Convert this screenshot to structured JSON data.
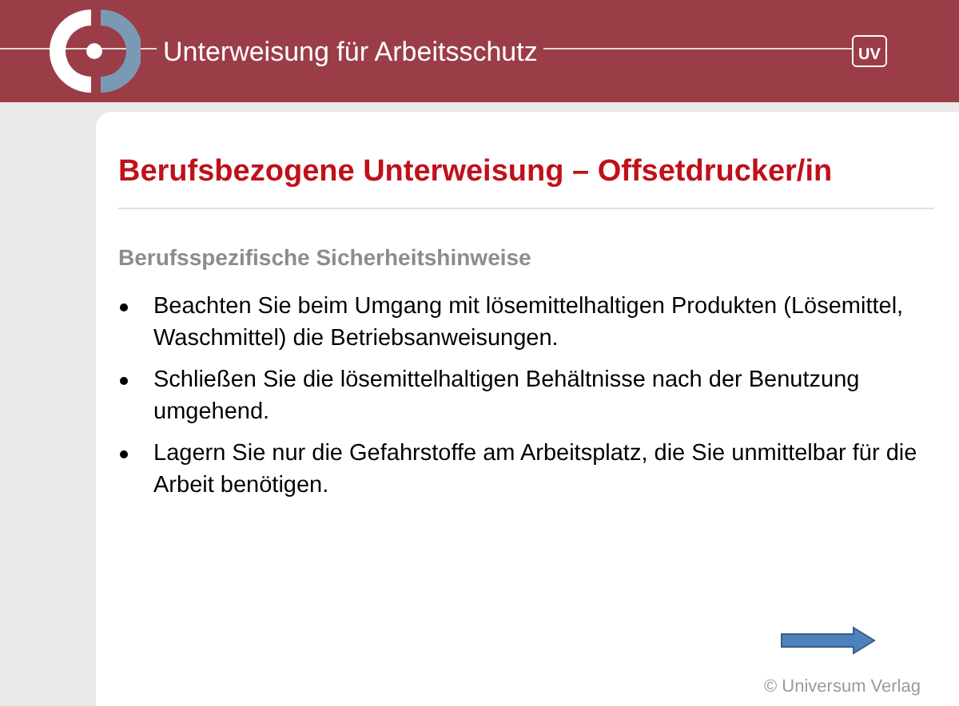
{
  "header": {
    "title": "Unterweisung für Arbeitsschutz",
    "badge": "UV"
  },
  "slide": {
    "title": "Berufsbezogene Unterweisung – Offsetdrucker/in",
    "subtitle": "Berufsspezifische Sicherheitshinweise",
    "bullets": [
      "Beachten Sie beim Umgang mit lösemittelhaltigen Produkten (Lösemittel, Waschmittel) die Betriebsanweisungen.",
      "Schließen Sie die lösemittelhaltigen Behältnisse nach der Benutzung umgehend.",
      "Lagern Sie nur die Gefahrstoffe am Arbeitsplatz, die Sie unmittelbar für die Arbeit benötigen."
    ],
    "copyright": "© Universum Verlag"
  }
}
